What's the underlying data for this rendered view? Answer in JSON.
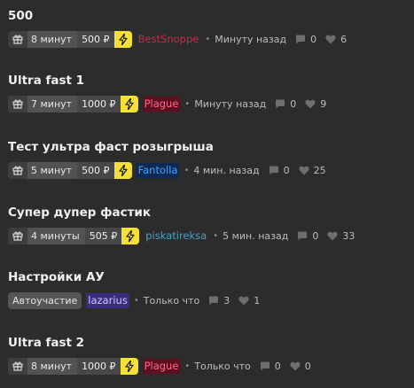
{
  "colors": {
    "background": "#2c2c2c",
    "bolt": "#f5e03a",
    "pill": "#474747"
  },
  "icons": {
    "gift": "gift-icon",
    "bolt": "lightning-icon",
    "comment": "comment-icon",
    "like": "heart-icon"
  },
  "posts": [
    {
      "title": "500",
      "duration": "8 минут",
      "price": "500 ₽",
      "has_bolt": true,
      "author": "BestSnoppe",
      "author_color": "#c72a55",
      "author_bg": "transparent",
      "time": "Минуту назад",
      "comments": "0",
      "likes": "6"
    },
    {
      "title": "Ultra fast 1",
      "duration": "7 минут",
      "price": "1000 ₽",
      "has_bolt": true,
      "author": "Plague",
      "author_color": "#ff6b8a",
      "author_bg": "#5c1020",
      "time": "Минуту назад",
      "comments": "0",
      "likes": "9"
    },
    {
      "title": "Тест ультра фаст розыгрыша",
      "duration": "5 минут",
      "price": "500 ₽",
      "has_bolt": true,
      "author": "Fantolla",
      "author_color": "#3ea2ff",
      "author_bg": "#0f2a52",
      "time": "4 мин. назад",
      "comments": "0",
      "likes": "25"
    },
    {
      "title": "Супер дупер фастик",
      "duration": "4 минуты",
      "price": "505 ₽",
      "has_bolt": true,
      "author": "piskatireksa",
      "author_color": "#4aa0c8",
      "author_bg": "transparent",
      "time": "5 мин. назад",
      "comments": "0",
      "likes": "33"
    },
    {
      "title": "Настройки АУ",
      "tag": "Автоучастие",
      "author": "lazarius",
      "author_color": "#cfc8ff",
      "author_bg": "#3a2d80",
      "time": "Только что",
      "comments": "3",
      "likes": "1"
    },
    {
      "title": "Ultra fast 2",
      "duration": "8 минут",
      "price": "1000 ₽",
      "has_bolt": true,
      "author": "Plague",
      "author_color": "#ff6b8a",
      "author_bg": "#5c1020",
      "time": "Только что",
      "comments": "0",
      "likes": "0"
    }
  ]
}
